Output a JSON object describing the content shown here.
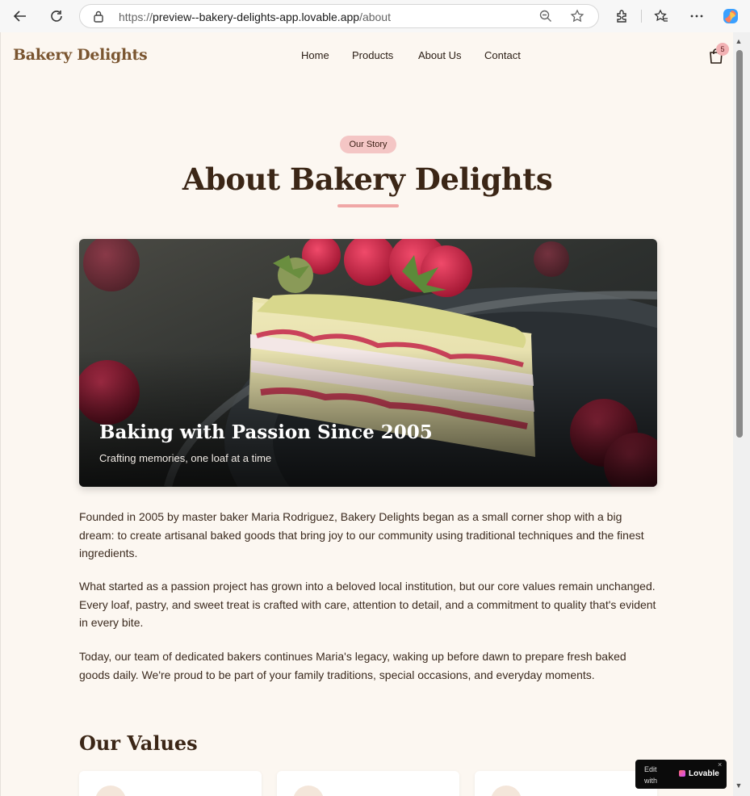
{
  "browser": {
    "url_prefix": "https://",
    "url_host": "preview--bakery-delights-app.lovable.app",
    "url_path": "/about"
  },
  "header": {
    "brand": "Bakery Delights",
    "nav": [
      "Home",
      "Products",
      "About Us",
      "Contact"
    ],
    "cart_count": "5"
  },
  "hero": {
    "pill": "Our Story",
    "title": "About Bakery Delights",
    "image_caption": "Baking with Passion Since 2005",
    "image_subcaption": "Crafting memories, one loaf at a time"
  },
  "story": {
    "paragraphs": [
      "Founded in 2005 by master baker Maria Rodriguez, Bakery Delights began as a small corner shop with a big dream: to create artisanal baked goods that bring joy to our community using traditional techniques and the finest ingredients.",
      "What started as a passion project has grown into a beloved local institution, but our core values remain unchanged. Every loaf, pastry, and sweet treat is crafted with care, attention to detail, and a commitment to quality that's evident in every bite.",
      "Today, our team of dedicated bakers continues Maria's legacy, waking up before dawn to prepare fresh baked goods daily. We're proud to be part of your family traditions, special occasions, and everyday moments."
    ]
  },
  "values": {
    "title": "Our Values"
  },
  "badge": {
    "edit_with": "Edit with",
    "brand": "Lovable",
    "close": "×"
  },
  "colors": {
    "page_bg": "#fcf7f1",
    "brand": "#7a5530",
    "heading": "#3b2616",
    "accent_pink": "#f0a7a6"
  }
}
